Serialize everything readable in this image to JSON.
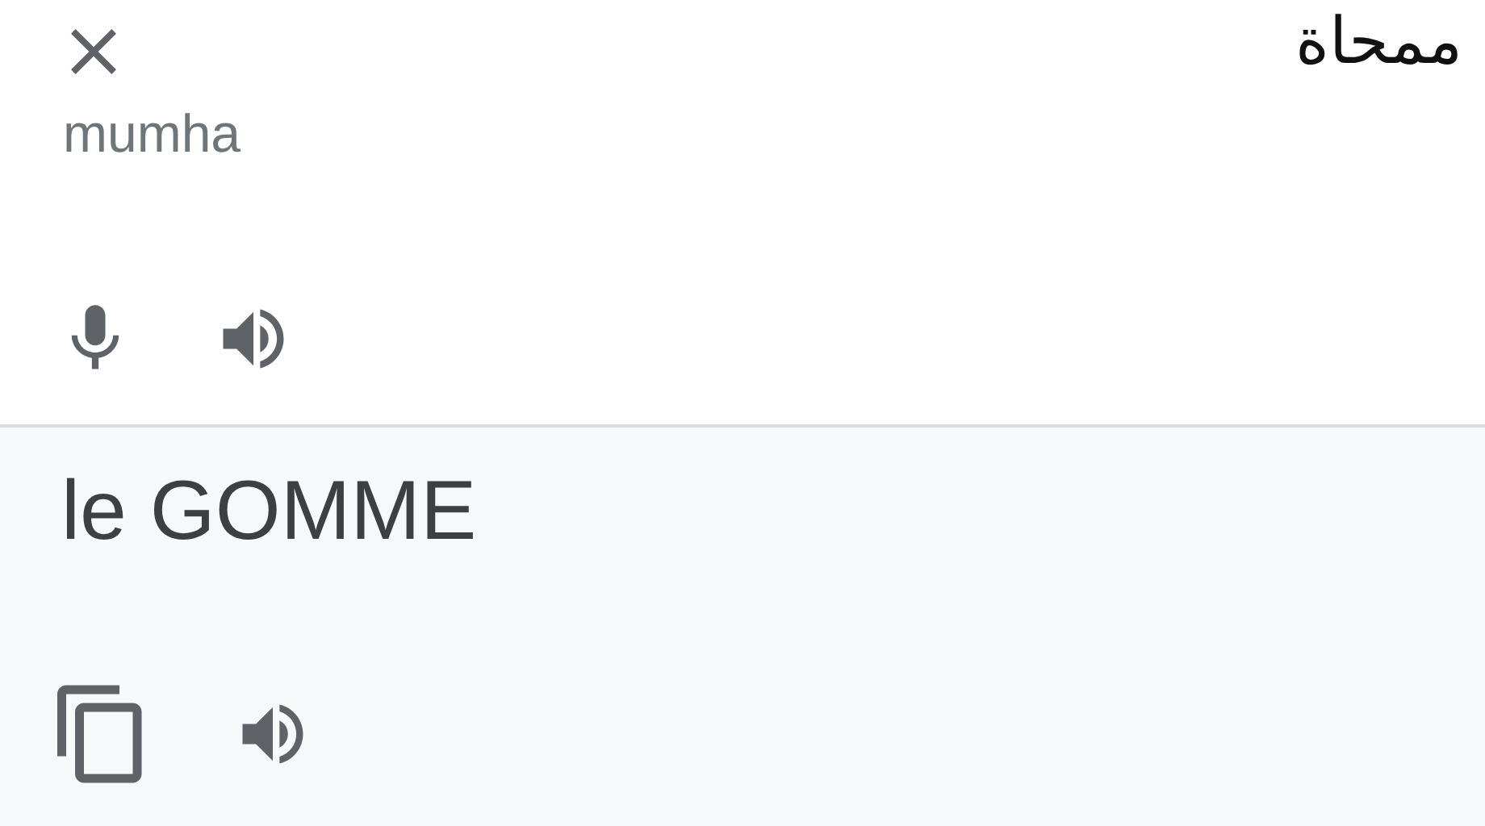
{
  "source": {
    "text": "ممحاة",
    "transliteration": "mumha"
  },
  "translation": {
    "text": "le GOMME"
  }
}
